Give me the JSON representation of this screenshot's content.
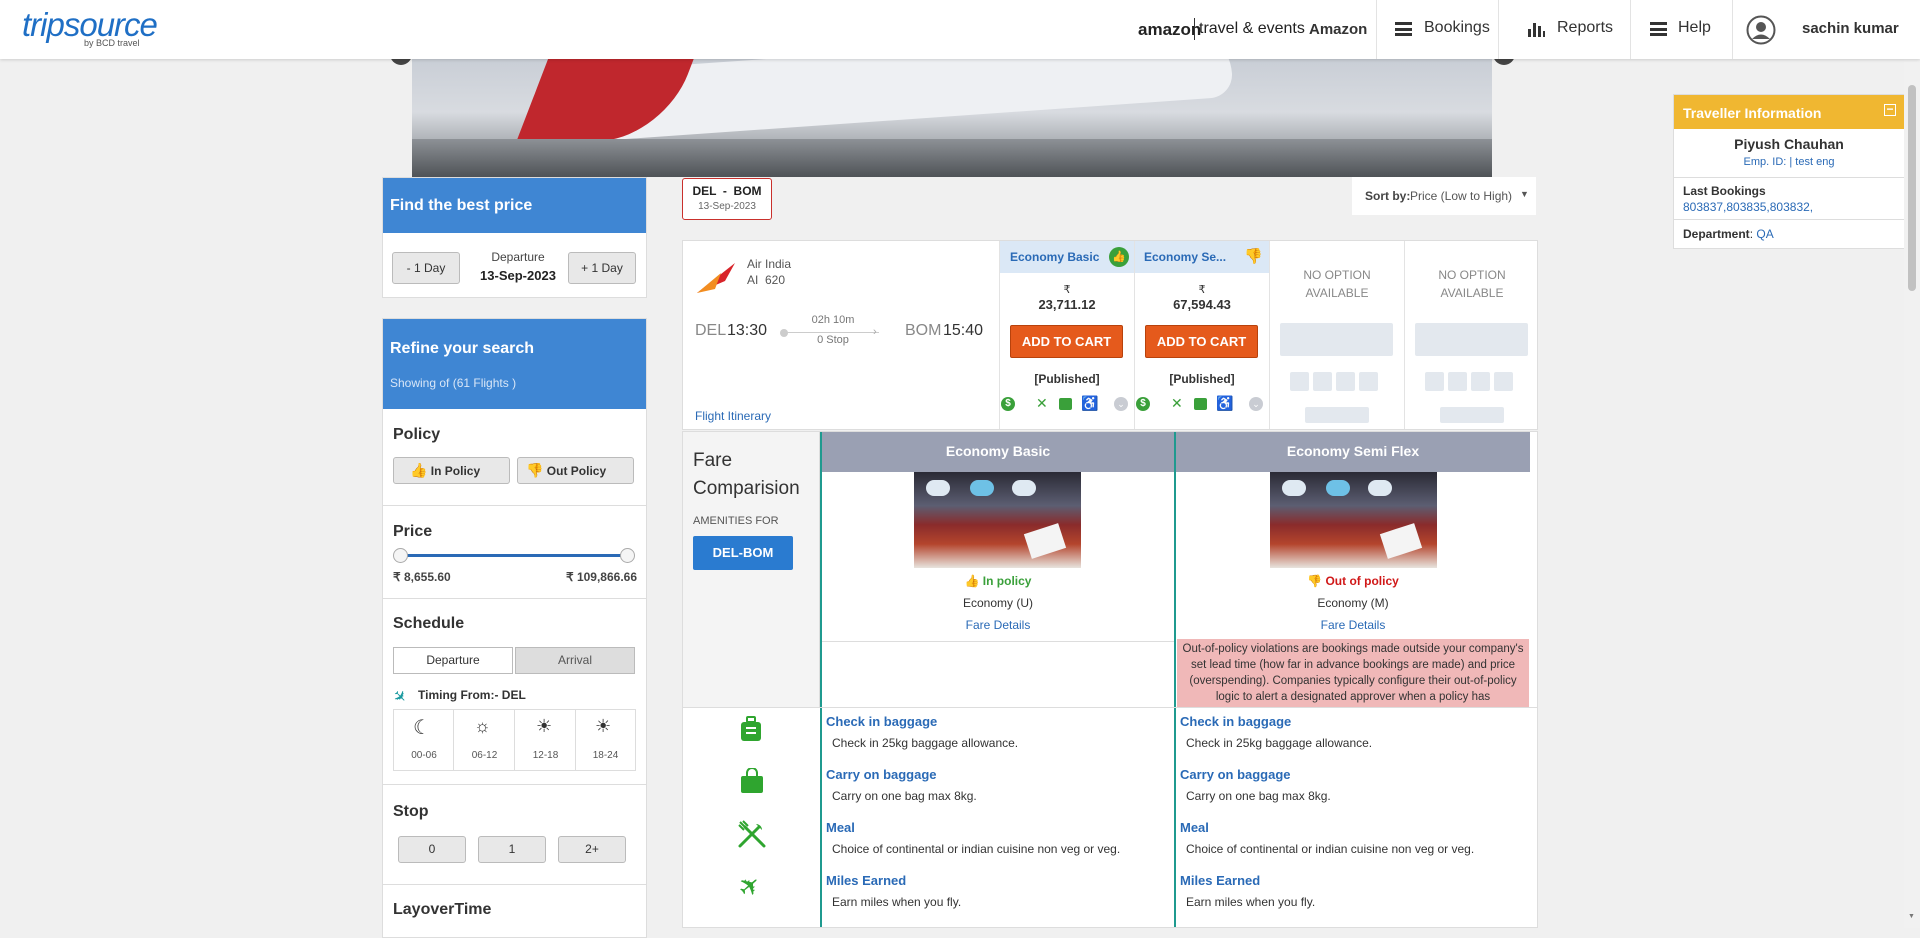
{
  "header": {
    "logo_main": "tripsource",
    "logo_sub": "by BCD travel",
    "amazon_brand": "amazon",
    "amazon_service": "travel & events",
    "company": "Amazon",
    "nav": [
      {
        "label": "Bookings"
      },
      {
        "label": "Reports"
      },
      {
        "label": "Help"
      }
    ],
    "user_name": "sachin kumar"
  },
  "best_price": {
    "title": "Find the best price",
    "prev_day": "- 1 Day",
    "next_day": "+ 1 Day",
    "departure_label": "Departure",
    "departure_date": "13-Sep-2023"
  },
  "route_chip": {
    "route": "DEL  -  BOM",
    "date": "13-Sep-2023"
  },
  "sort": {
    "label": "Sort by:",
    "value": "Price (Low to High)"
  },
  "refine": {
    "title": "Refine your search",
    "showing": "Showing of (61 Flights )",
    "policy_title": "Policy",
    "in_policy": "In Policy",
    "out_policy": "Out Policy",
    "price_title": "Price",
    "price_min": "₹ 8,655.60",
    "price_max": "₹ 109,866.66",
    "schedule_title": "Schedule",
    "tab_departure": "Departure",
    "tab_arrival": "Arrival",
    "timing_from": "Timing From:- DEL",
    "slots": [
      "00-06",
      "06-12",
      "12-18",
      "18-24"
    ],
    "stop_title": "Stop",
    "stops": [
      "0",
      "1",
      "2+"
    ],
    "layover_title": "LayoverTime"
  },
  "flight": {
    "airline": "Air India",
    "flight_no": "AI  620",
    "from": "DEL",
    "dep_time": "13:30",
    "duration": "02h 10m",
    "stops": "0 Stop",
    "to": "BOM",
    "arr_time": "15:40",
    "itinerary_link": "Flight Itinerary",
    "fares": [
      {
        "name": "Economy Basic",
        "currency": "₹",
        "price": "23,711.12",
        "cta": "ADD TO CART",
        "tag": "[Published]"
      },
      {
        "name": "Economy Se...",
        "currency": "₹",
        "price": "67,594.43",
        "cta": "ADD TO CART",
        "tag": "[Published]"
      }
    ],
    "no_option": "NO OPTION AVAILABLE"
  },
  "fare_comparison": {
    "title_line1": "Fare",
    "title_line2": "Comparision",
    "amenities_for": "AMENITIES FOR",
    "route": "DEL-BOM",
    "columns": [
      {
        "name": "Economy Basic",
        "policy": "In policy",
        "cabin": "Economy (U)",
        "details": "Fare Details",
        "violation": ""
      },
      {
        "name": "Economy Semi Flex",
        "policy": "Out of policy",
        "cabin": "Economy (M)",
        "details": "Fare Details",
        "violation": "Out-of-policy violations are bookings made outside your company's set lead time (how far in advance bookings are made) and price (overspending). Companies typically configure their out-of-policy logic to alert a designated approver when a policy has"
      }
    ],
    "amenities": [
      {
        "title": "Check in baggage",
        "desc": "Check in 25kg baggage allowance.",
        "icon": "luggage-icon"
      },
      {
        "title": "Carry on baggage",
        "desc": "Carry on one bag max 8kg.",
        "icon": "bag-icon"
      },
      {
        "title": "Meal",
        "desc": "Choice of continental or indian cuisine non veg or veg.",
        "icon": "meal-icon"
      },
      {
        "title": "Miles Earned",
        "desc": "Earn miles when you fly.",
        "icon": "plane-icon"
      }
    ]
  },
  "traveller": {
    "title": "Traveller Information",
    "name": "Piyush Chauhan",
    "emp": "Emp. ID: | test eng",
    "last_bookings_label": "Last Bookings",
    "last_bookings": "803837,803835,803832,",
    "department_label": "Department",
    "department": "QA"
  },
  "colors": {
    "accent": "#3f86d3",
    "cta": "#e55a1c",
    "policy_in": "#3aa03a",
    "policy_out": "#d01818",
    "traveller_head": "#f0b731",
    "fare_head": "#9aa0b3"
  }
}
